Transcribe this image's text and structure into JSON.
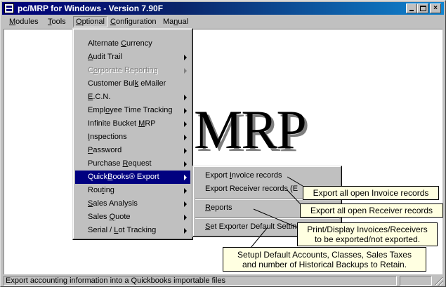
{
  "window": {
    "title": "pc/MRP for Windows - Version 7.90F",
    "buttons": {
      "minimize": "minimize",
      "maximize": "maximize",
      "close": "×"
    }
  },
  "menubar": {
    "modules": {
      "u": "M",
      "rest": "odules"
    },
    "tools": {
      "u": "T",
      "rest": "ools"
    },
    "optional": {
      "u": "O",
      "rest": "ptional"
    },
    "configuration": {
      "u": "C",
      "rest": "onfiguration"
    },
    "manual": {
      "pre": "Ma",
      "u": "n",
      "rest": "ual"
    }
  },
  "logo": {
    "text": "MRP"
  },
  "optional_menu": {
    "alternate_currency": {
      "pre": "Alternate ",
      "u": "C",
      "rest": "urrency"
    },
    "audit_trail": {
      "pre": "",
      "u": "A",
      "rest": "udit Trail"
    },
    "corporate_reporting": {
      "pre": "C",
      "u": "o",
      "rest": "rporate Reporting"
    },
    "customer_bulk_emailer": {
      "pre": "Customer Bul",
      "u": "k",
      "rest": " eMailer"
    },
    "ecn": {
      "pre": "",
      "u": "E",
      "rest": ".C.N."
    },
    "employee_time_tracking": {
      "pre": "Empl",
      "u": "o",
      "rest": "yee Time Tracking"
    },
    "infinite_bucket_mrp": {
      "pre": "Infinite Bucket ",
      "u": "M",
      "rest": "RP"
    },
    "inspections": {
      "pre": "",
      "u": "I",
      "rest": "nspections"
    },
    "password": {
      "pre": "",
      "u": "P",
      "rest": "assword"
    },
    "purchase_request": {
      "pre": "Purchase ",
      "u": "R",
      "rest": "equest"
    },
    "quickbooks_export": {
      "pre": "Quick",
      "u": "B",
      "rest": "ooks® Export"
    },
    "routing": {
      "pre": "Rou",
      "u": "t",
      "rest": "ing"
    },
    "sales_analysis": {
      "pre": "",
      "u": "S",
      "rest": "ales Analysis"
    },
    "sales_quote": {
      "pre": "Sales ",
      "u": "Q",
      "rest": "uote"
    },
    "serial_lot_tracking": {
      "pre": "Serial / ",
      "u": "L",
      "rest": "ot Tracking"
    }
  },
  "qb_submenu": {
    "export_invoice": {
      "pre": "Export ",
      "u": "I",
      "rest": "nvoice records"
    },
    "export_receiver": {
      "pre": "Export Receiver records  (E",
      "u": "",
      "rest": ""
    },
    "reports": {
      "pre": "",
      "u": "R",
      "rest": "eports"
    },
    "set_defaults": {
      "pre": "",
      "u": "S",
      "rest": "et Exporter Default Settings"
    }
  },
  "callouts": {
    "invoice": "Export all open Invoice records",
    "receiver": "Export all open Receiver records",
    "reports_line1": "Print/Display Invoices/Receivers",
    "reports_line2": "to be exported/not exported.",
    "defaults_line1": "Setupl  Default Accounts, Classes, Sales Taxes",
    "defaults_line2": "and number of Historical Backups to Retain."
  },
  "statusbar": {
    "text": "Export accounting information into a Quickbooks importable files"
  },
  "colors": {
    "title_start": "#00007b",
    "title_end": "#1084d0",
    "menu_highlight": "#000080",
    "callout_bg": "#ffffe1",
    "face": "#c0c0c0"
  }
}
